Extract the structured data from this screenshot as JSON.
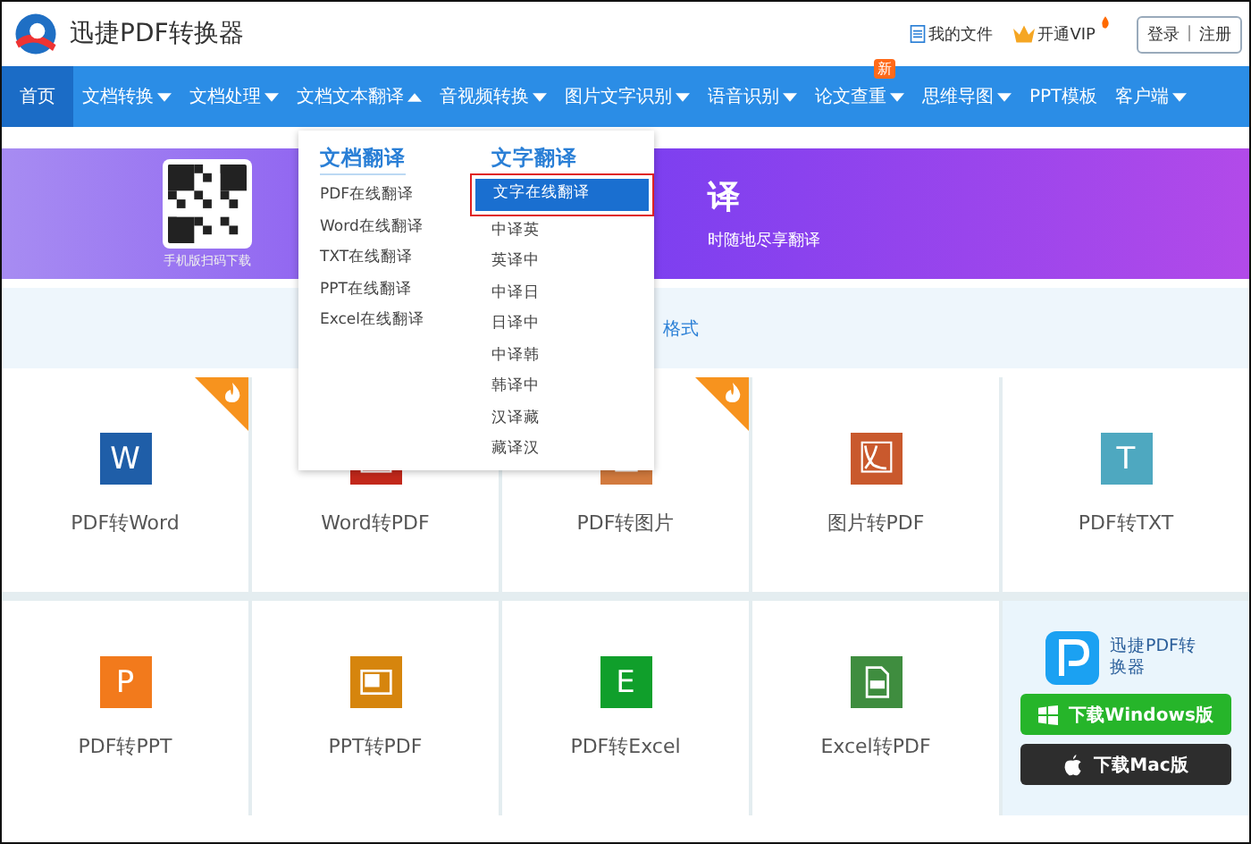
{
  "header": {
    "logo_text": "迅捷PDF转换器",
    "links": [
      {
        "label": "我的文件",
        "kind": "file"
      },
      {
        "label": "开通VIP",
        "kind": "vip"
      }
    ],
    "login": "登录",
    "separator": "|",
    "register": "注册"
  },
  "nav": [
    {
      "label": "首页",
      "selected": true,
      "kind": "link"
    },
    {
      "label": "文档转换",
      "selected": false,
      "kind": "menu"
    },
    {
      "label": "文档处理",
      "selected": false,
      "kind": "menu"
    },
    {
      "label": "文档文本翻译",
      "selected": false,
      "kind": "open"
    },
    {
      "label": "音视频转换",
      "selected": false,
      "kind": "menu"
    },
    {
      "label": "图片文字识别",
      "selected": false,
      "kind": "menu"
    },
    {
      "label": "语音识别",
      "selected": false,
      "kind": "menu"
    },
    {
      "label": "论文查重",
      "selected": false,
      "kind": "menu",
      "badge": "新"
    },
    {
      "label": "思维导图",
      "selected": false,
      "kind": "menu"
    },
    {
      "label": "PPT模板",
      "selected": false,
      "kind": "link"
    },
    {
      "label": "客户端",
      "selected": false,
      "kind": "menu"
    }
  ],
  "dropdown": {
    "columns": [
      {
        "heading": "文档翻译",
        "items": [
          {
            "label": "PDF在线翻译",
            "selected": false
          },
          {
            "label": "Word在线翻译",
            "selected": false
          },
          {
            "label": "TXT在线翻译",
            "selected": false
          },
          {
            "label": "PPT在线翻译",
            "selected": false
          },
          {
            "label": "Excel在线翻译",
            "selected": false
          }
        ]
      },
      {
        "heading": "文字翻译",
        "items": [
          {
            "label": "文字在线翻译",
            "selected": true
          },
          {
            "label": "中译英",
            "selected": false
          },
          {
            "label": "英译中",
            "selected": false
          },
          {
            "label": "中译日",
            "selected": false
          },
          {
            "label": "日译中",
            "selected": false
          },
          {
            "label": "中译韩",
            "selected": false
          },
          {
            "label": "韩译中",
            "selected": false
          },
          {
            "label": "汉译藏",
            "selected": false
          },
          {
            "label": "藏译汉",
            "selected": false
          }
        ]
      }
    ]
  },
  "banner": {
    "qr_caption": "手机版扫码下载",
    "title": "译",
    "subtitle": "时随地尽享翻译"
  },
  "info_band": {
    "text": "格式"
  },
  "tools": [
    {
      "label": "PDF转Word",
      "kind": "letter",
      "letter": "W",
      "color": "#1f5ea8",
      "hot": true
    },
    {
      "label": "Word转PDF",
      "kind": "pdf",
      "color": "#c2281b",
      "hot": false
    },
    {
      "label": "PDF转图片",
      "kind": "image",
      "color": "#d27a3e",
      "hot": true
    },
    {
      "label": "图片转PDF",
      "kind": "pdf",
      "color": "#c9592d",
      "hot": false
    },
    {
      "label": "PDF转TXT",
      "kind": "letter",
      "letter": "T",
      "color": "#4ea8c0",
      "hot": false
    },
    {
      "label": "PDF转PPT",
      "kind": "letter",
      "letter": "P",
      "color": "#f27a1c",
      "hot": false
    },
    {
      "label": "PPT转PDF",
      "kind": "slide",
      "color": "#d6850d",
      "hot": false
    },
    {
      "label": "PDF转Excel",
      "kind": "letter",
      "letter": "E",
      "color": "#109f2b",
      "hot": false
    },
    {
      "label": "Excel转PDF",
      "kind": "doc",
      "color": "#3f8d3f",
      "hot": false
    }
  ],
  "app_panel": {
    "name": "迅捷PDF转换器",
    "buttons": [
      {
        "label": "下载Windows版",
        "kind": "windows"
      },
      {
        "label": "下载Mac版",
        "kind": "mac"
      }
    ]
  }
}
